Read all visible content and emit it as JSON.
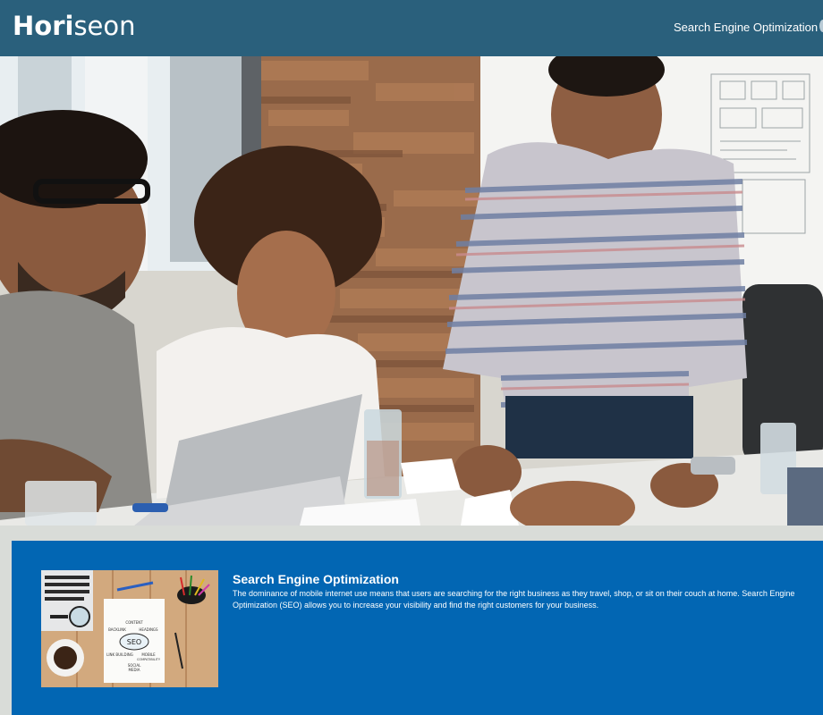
{
  "header": {
    "logo_bold": "Hori",
    "logo_rest": "seon",
    "nav": {
      "item_1": "Search Engine Optimization"
    }
  },
  "hero": {
    "image": "team-meeting-photo"
  },
  "content": {
    "seo": {
      "title": "Search Engine Optimization",
      "text": "The dominance of mobile internet use means that users are searching for the right business as they travel, shop, or sit on their couch at home. Search Engine Optimization (SEO) allows you to increase your visibility and find the right customers for your business.",
      "image": "seo-notebook-illustration",
      "image_words": [
        "CONTENT",
        "HEADINGS",
        "BACKLINK",
        "SEO",
        "MOBILE COMPATIBILITY",
        "LINK BUILDING",
        "SOCIAL MEDIA"
      ]
    }
  },
  "colors": {
    "header_bg": "#2a607c",
    "content_bg": "#0266b3",
    "page_bg": "#d9dcd8"
  }
}
